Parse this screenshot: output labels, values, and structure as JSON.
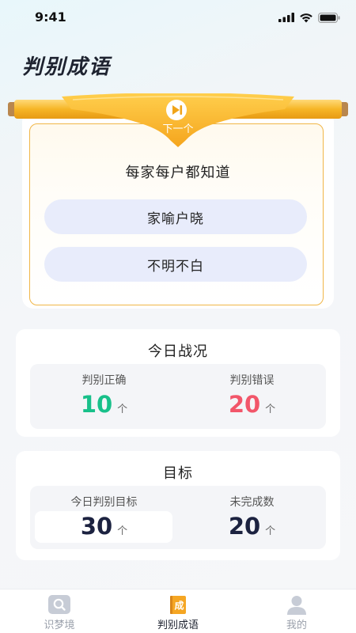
{
  "status_bar": {
    "time": "9:41"
  },
  "page": {
    "title": "判别成语"
  },
  "question": {
    "next_label": "下一个",
    "prompt": "每家每户都知道",
    "options": [
      "家喻户晓",
      "不明不白"
    ]
  },
  "today_stats": {
    "title": "今日战况",
    "correct_label": "判别正确",
    "correct_value": "10",
    "correct_unit": "个",
    "wrong_label": "判别错误",
    "wrong_value": "20",
    "wrong_unit": "个"
  },
  "goal": {
    "title": "目标",
    "target_label": "今日判别目标",
    "target_value": "30",
    "target_unit": "个",
    "remaining_label": "未完成数",
    "remaining_value": "20",
    "remaining_unit": "个"
  },
  "tabbar": {
    "tabs": [
      {
        "label": "识梦境",
        "icon": "search-icon"
      },
      {
        "label": "判别成语",
        "icon": "idiom-book-icon",
        "icon_char": "成"
      },
      {
        "label": "我的",
        "icon": "user-icon"
      }
    ],
    "active_index": 1
  },
  "colors": {
    "correct": "#18c08a",
    "wrong": "#f2566a",
    "accent_gold": "#f5b92e",
    "option_bg": "#e8ecfb"
  }
}
